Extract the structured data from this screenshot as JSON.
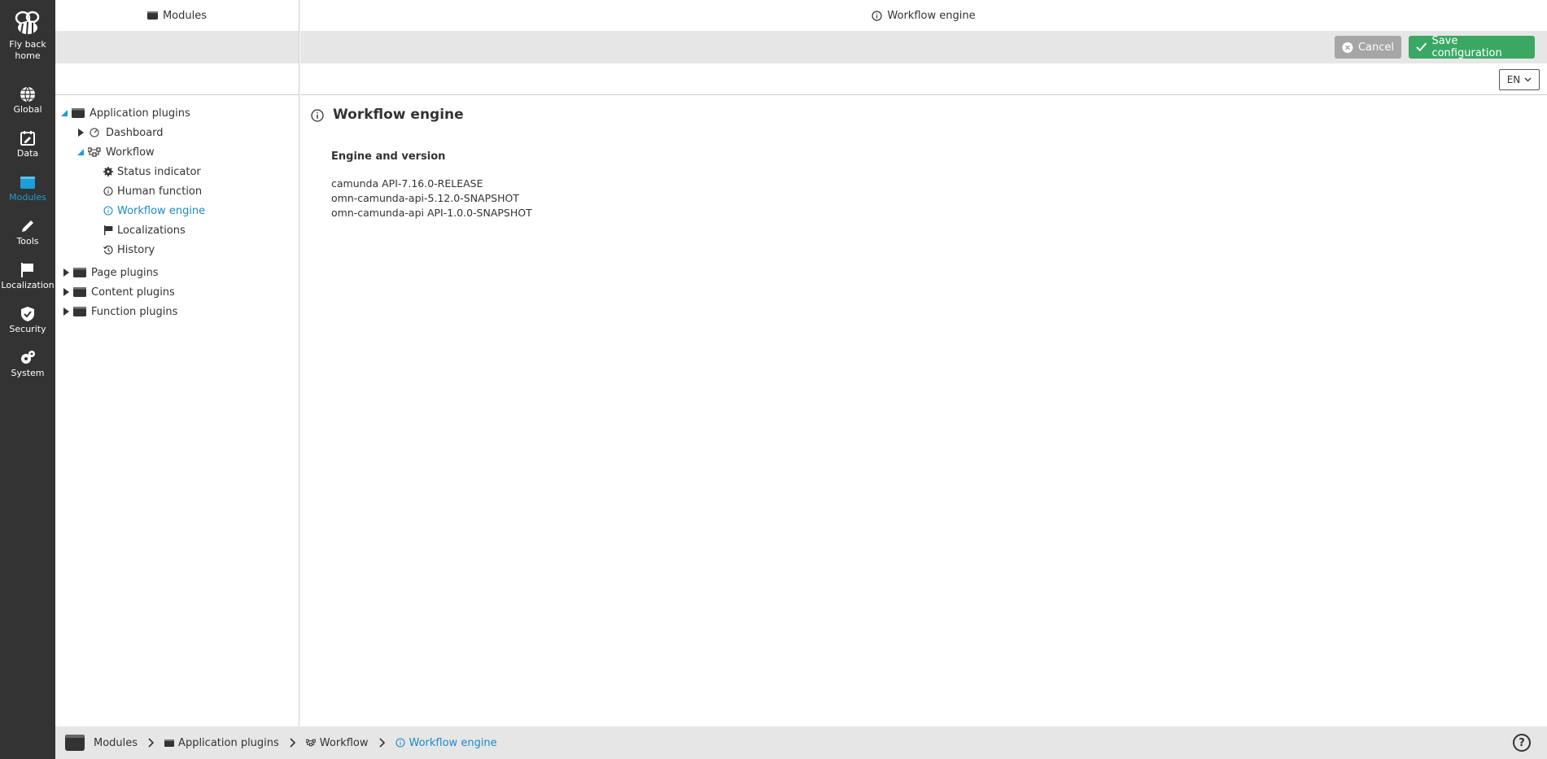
{
  "rail": {
    "home_label": "Fly back home",
    "items": [
      {
        "label": "Global"
      },
      {
        "label": "Data"
      },
      {
        "label": "Modules"
      },
      {
        "label": "Tools"
      },
      {
        "label": "Localization"
      },
      {
        "label": "Security"
      },
      {
        "label": "System"
      }
    ],
    "active_index": 2,
    "accent_color": "#1a9fd8"
  },
  "header": {
    "left_title": "Modules",
    "right_title": "Workflow engine"
  },
  "toolbar": {
    "cancel_label": "Cancel",
    "save_label": "Save configuration",
    "save_color": "#3aa863",
    "language": "EN"
  },
  "tree": {
    "items": [
      {
        "label": "Application plugins"
      },
      {
        "label": "Dashboard"
      },
      {
        "label": "Workflow"
      },
      {
        "label": "Status indicator"
      },
      {
        "label": "Human function"
      },
      {
        "label": "Workflow engine"
      },
      {
        "label": "Localizations"
      },
      {
        "label": "History"
      },
      {
        "label": "Page plugins"
      },
      {
        "label": "Content plugins"
      },
      {
        "label": "Function plugins"
      }
    ],
    "selected_index": 5
  },
  "main": {
    "title": "Workflow engine",
    "section_title": "Engine and version",
    "versions": [
      "camunda API-7.16.0-RELEASE",
      "omn-camunda-api-5.12.0-SNAPSHOT",
      "omn-camunda-api API-1.0.0-SNAPSHOT"
    ]
  },
  "footer": {
    "crumbs": [
      "Modules",
      "Application plugins",
      "Workflow",
      "Workflow engine"
    ],
    "help_label": "?"
  }
}
